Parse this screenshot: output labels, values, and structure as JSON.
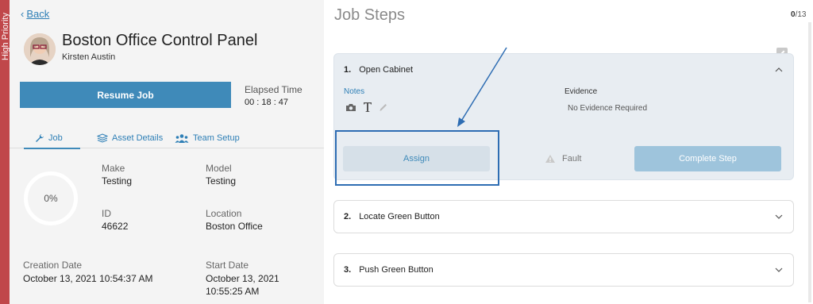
{
  "priority": {
    "label": "High Priority",
    "color": "#c0474a"
  },
  "nav": {
    "back_label": "Back"
  },
  "job": {
    "title": "Boston Office Control Panel",
    "assignee": "Kirsten Austin",
    "resume_label": "Resume Job",
    "elapsed_label": "Elapsed Time",
    "elapsed_value": "00 : 18 : 47"
  },
  "tabs": [
    {
      "label": "Job",
      "icon": "wrench-icon",
      "active": true
    },
    {
      "label": "Asset Details",
      "icon": "layers-icon",
      "active": false
    },
    {
      "label": "Team Setup",
      "icon": "team-icon",
      "active": false
    }
  ],
  "progress": {
    "label": "0%",
    "value": 0
  },
  "fields": {
    "make_label": "Make",
    "make_value": "Testing",
    "model_label": "Model",
    "model_value": "Testing",
    "id_label": "ID",
    "id_value": "46622",
    "location_label": "Location",
    "location_value": "Boston Office",
    "creation_label": "Creation Date",
    "creation_value": "October 13, 2021 10:54:37 AM",
    "start_label": "Start Date",
    "start_value_line1": "October 13, 2021",
    "start_value_line2": "10:55:25 AM"
  },
  "steps_panel": {
    "title": "Job Steps",
    "counter_done": "0",
    "counter_total": "/13",
    "steps": [
      {
        "number": "1.",
        "name": "Open Cabinet",
        "notes_label": "Notes",
        "evidence_label": "Evidence",
        "evidence_value": "No Evidence Required",
        "assign_label": "Assign",
        "fault_label": "Fault",
        "complete_label": "Complete Step"
      },
      {
        "number": "2.",
        "name": "Locate Green Button"
      },
      {
        "number": "3.",
        "name": "Push Green Button"
      }
    ]
  },
  "colors": {
    "accent": "#3f8ab9",
    "link": "#2e7fb6",
    "highlight": "#2e6db3"
  }
}
